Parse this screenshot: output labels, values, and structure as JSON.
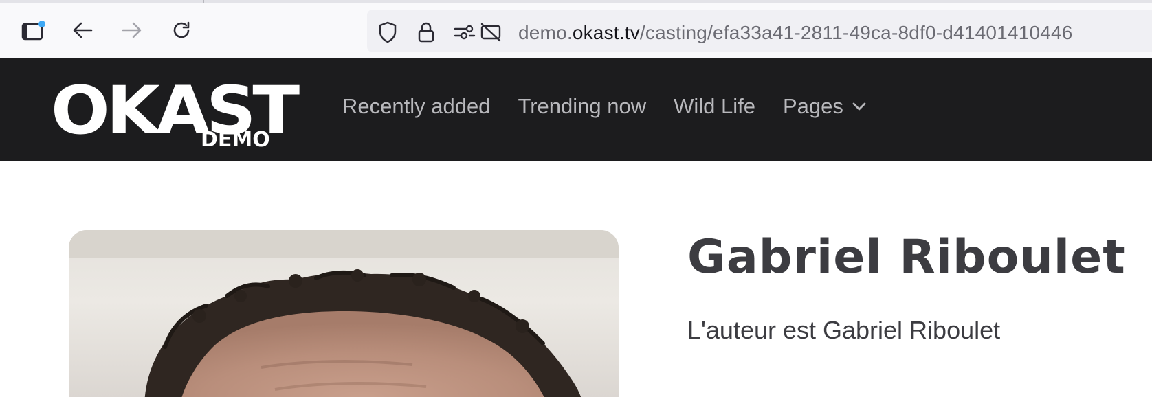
{
  "browser": {
    "url_prefix": "demo.",
    "url_host": "okast.tv",
    "url_path": "/casting/efa33a41-2811-49ca-8df0-d41401410446",
    "icons": [
      "sidebar-toggle-icon",
      "back-arrow-icon",
      "forward-arrow-icon",
      "reload-icon",
      "shield-icon",
      "lock-icon",
      "permissions-icon",
      "camera-blocked-icon"
    ]
  },
  "site": {
    "logo_main": "OKAST",
    "logo_sub": "DEMO",
    "nav": [
      {
        "label": "Recently added"
      },
      {
        "label": "Trending now"
      },
      {
        "label": "Wild Life"
      },
      {
        "label": "Pages"
      }
    ]
  },
  "person": {
    "name": "Gabriel Riboulet",
    "description": "L'auteur est Gabriel Riboulet"
  },
  "colors": {
    "header_bg": "#1c1c1e",
    "nav_text": "#b8b8bc",
    "title_text": "#3c3c41"
  }
}
